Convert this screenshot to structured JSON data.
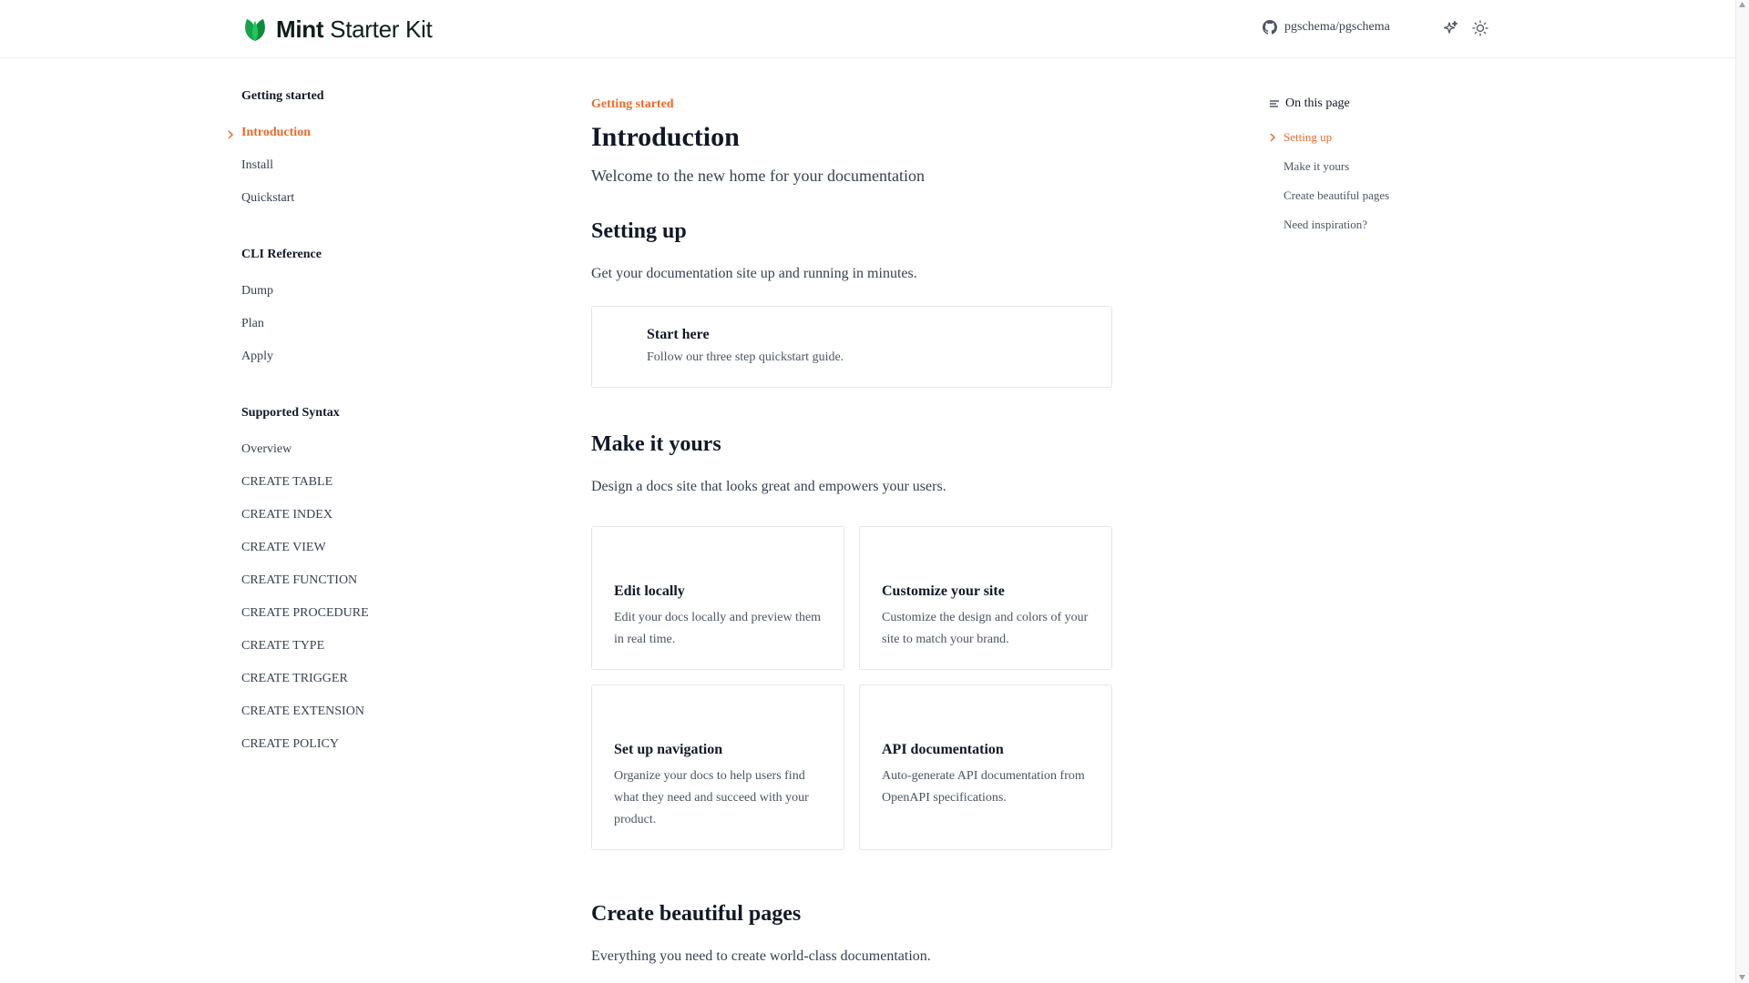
{
  "header": {
    "logo_bold": "Mint",
    "logo_rest": " Starter Kit",
    "repo": "pgschema/pgschema"
  },
  "sidebar": {
    "groups": [
      {
        "title": "Getting started",
        "items": [
          "Introduction",
          "Install",
          "Quickstart"
        ]
      },
      {
        "title": "CLI Reference",
        "items": [
          "Dump",
          "Plan",
          "Apply"
        ]
      },
      {
        "title": "Supported Syntax",
        "items": [
          "Overview",
          "CREATE TABLE",
          "CREATE INDEX",
          "CREATE VIEW",
          "CREATE FUNCTION",
          "CREATE PROCEDURE",
          "CREATE TYPE",
          "CREATE TRIGGER",
          "CREATE EXTENSION",
          "CREATE POLICY"
        ]
      }
    ]
  },
  "main": {
    "breadcrumb": "Getting started",
    "title": "Introduction",
    "subtitle": "Welcome to the new home for your documentation",
    "sections": [
      {
        "heading": "Setting up",
        "text": "Get your documentation site up and running in minutes.",
        "cards": [
          {
            "title": "Start here",
            "description": "Follow our three step quickstart guide."
          }
        ]
      },
      {
        "heading": "Make it yours",
        "text": "Design a docs site that looks great and empowers your users.",
        "cards": [
          {
            "title": "Edit locally",
            "description": "Edit your docs locally and preview them in real time."
          },
          {
            "title": "Customize your site",
            "description": "Customize the design and colors of your site to match your brand."
          },
          {
            "title": "Set up navigation",
            "description": "Organize your docs to help users find what they need and succeed with your product."
          },
          {
            "title": "API documentation",
            "description": "Auto-generate API documentation from OpenAPI specifications."
          }
        ]
      },
      {
        "heading": "Create beautiful pages",
        "text": "Everything you need to create world-class documentation."
      }
    ]
  },
  "toc": {
    "heading": "On this page",
    "items": [
      "Setting up",
      "Make it yours",
      "Create beautiful pages",
      "Need inspiration?"
    ]
  },
  "colors": {
    "accent": "#ea6a2a",
    "brand_leaf": "#16a34a",
    "text": "#111827",
    "muted": "#374151"
  },
  "icons": {
    "logo": "leaf-logo-icon",
    "repo": "github-icon",
    "assistant": "sparkles-icon",
    "theme": "sun-icon",
    "toc": "list-icon",
    "active_marker": "chevron-right-icon"
  }
}
